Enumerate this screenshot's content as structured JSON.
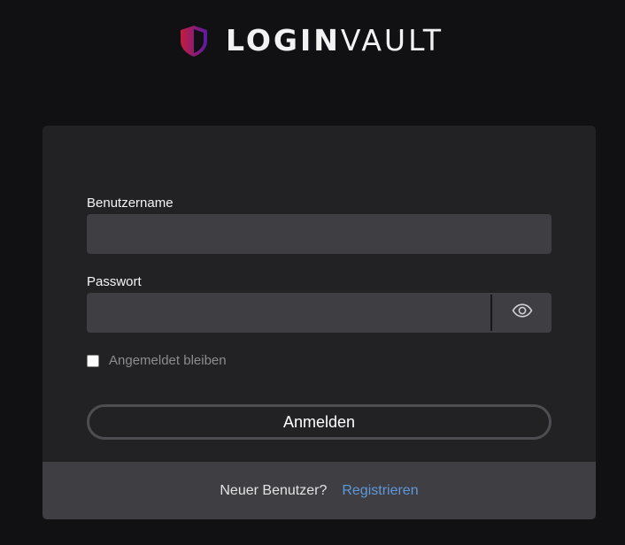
{
  "brand": {
    "logo_icon": "shield-icon",
    "name_bold": "LOGIN",
    "name_light": "VAULT",
    "shield_colors": [
      "#c41d3a",
      "#5a1aa6"
    ]
  },
  "form": {
    "username_label": "Benutzername",
    "username_value": "",
    "password_label": "Passwort",
    "password_value": "",
    "show_password_icon": "eye-icon",
    "remember_label": "Angemeldet bleiben",
    "remember_checked": false,
    "submit_label": "Anmelden"
  },
  "footer": {
    "question": "Neuer Benutzer?",
    "register_link": "Registrieren",
    "link_color": "#5f98da"
  }
}
